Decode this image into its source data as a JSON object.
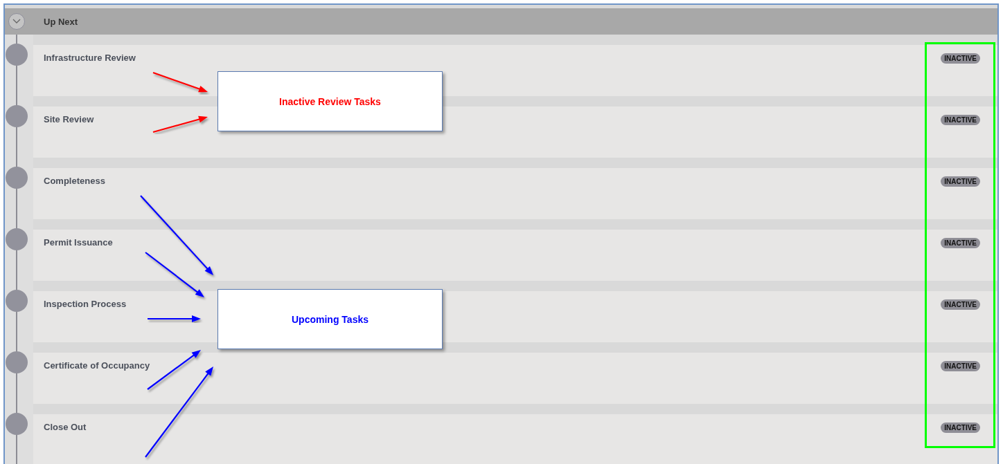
{
  "section": {
    "title": "Up Next",
    "expanded": true
  },
  "tasks": [
    {
      "name": "Infrastructure Review",
      "status": "INACTIVE"
    },
    {
      "name": "Site Review",
      "status": "INACTIVE"
    },
    {
      "name": "Completeness",
      "status": "INACTIVE"
    },
    {
      "name": "Permit Issuance",
      "status": "INACTIVE"
    },
    {
      "name": "Inspection Process",
      "status": "INACTIVE"
    },
    {
      "name": "Certificate of Occupancy",
      "status": "INACTIVE"
    },
    {
      "name": "Close Out",
      "status": "INACTIVE"
    }
  ],
  "callouts": [
    {
      "text": "Inactive Review Tasks",
      "color": "#ff0000"
    },
    {
      "text": "Upcoming Tasks",
      "color": "#0000ff"
    }
  ]
}
